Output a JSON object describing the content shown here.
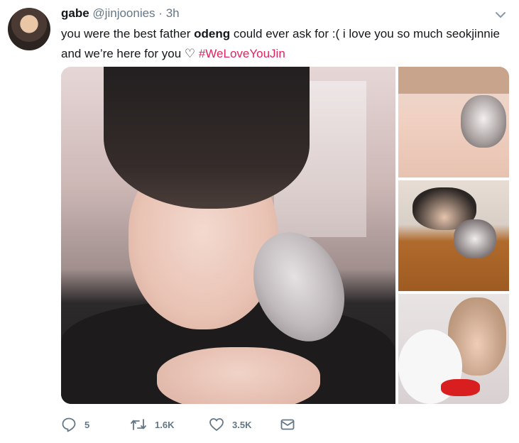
{
  "tweet": {
    "display_name": "gabe",
    "handle": "@jinjoonies",
    "separator": "·",
    "timestamp": "3h",
    "text_part1": "you were the best father ",
    "text_bold": "odeng",
    "text_part2": " could ever ask for :( i love you so much seokjinnie and we’re here for you ♡ ",
    "hashtag": "#WeLoveYouJin",
    "media_count": 4
  },
  "actions": {
    "reply_count": "5",
    "retweet_count": "1.6K",
    "like_count": "3.5K"
  },
  "icons": [
    "chevron-down-icon",
    "reply-icon",
    "retweet-icon",
    "like-icon",
    "message-icon"
  ],
  "colors": {
    "hashtag": "#e0245e",
    "secondary_text": "#657786",
    "primary_text": "#14171a"
  }
}
